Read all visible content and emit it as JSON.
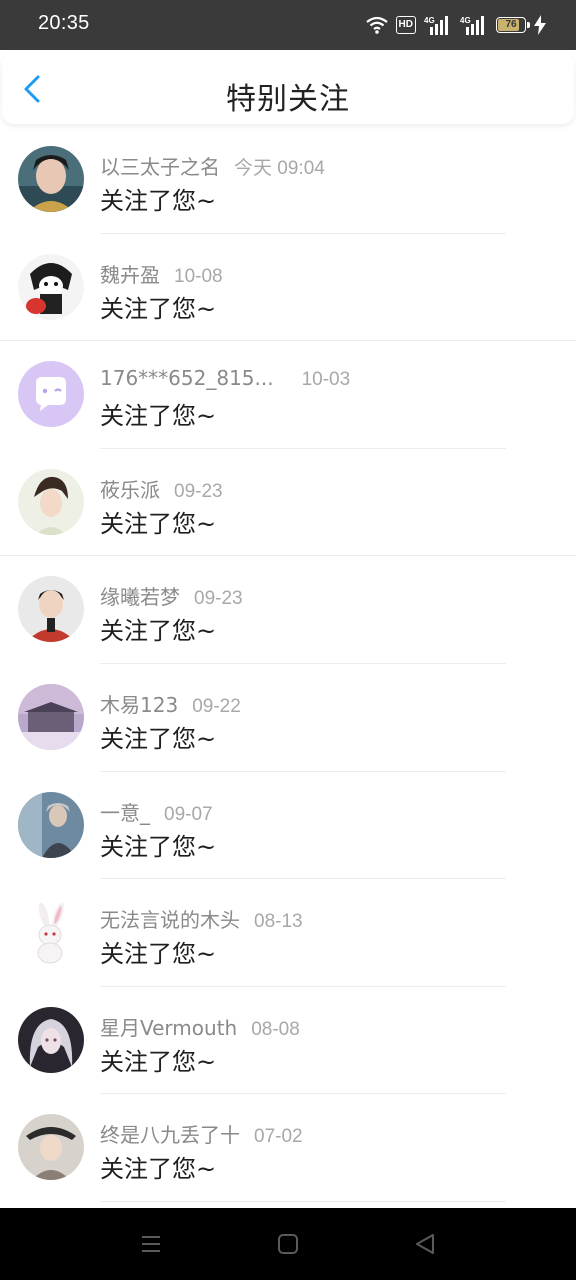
{
  "status_bar": {
    "time": "20:35",
    "hd_label": "HD",
    "signal_label_1": "4G",
    "signal_label_2": "4G",
    "battery_level": "76",
    "battery_fill_fraction": 0.76,
    "battery_color": "#c8b26e"
  },
  "header": {
    "title": "特别关注",
    "back_icon": "chevron-left-icon",
    "accent_color": "#1e9bf0"
  },
  "list": {
    "items": [
      {
        "name": "以三太子之名",
        "date": "今天 09:04",
        "message": "关注了您~",
        "avatar_icon": "user-photo"
      },
      {
        "name": "魏卉盈",
        "date": "10-08",
        "message": "关注了您~",
        "avatar_icon": "user-photo"
      },
      {
        "name": "176***652_815...",
        "date": "10-03",
        "message": "关注了您~",
        "avatar_icon": "default-chat-avatar"
      },
      {
        "name": "莜乐派",
        "date": "09-23",
        "message": "关注了您~",
        "avatar_icon": "user-photo"
      },
      {
        "name": "缘曦若梦",
        "date": "09-23",
        "message": "关注了您~",
        "avatar_icon": "user-photo"
      },
      {
        "name": "木易123",
        "date": "09-22",
        "message": "关注了您~",
        "avatar_icon": "user-photo"
      },
      {
        "name": "一意_",
        "date": "09-07",
        "message": "关注了您~",
        "avatar_icon": "user-photo"
      },
      {
        "name": "无法言说的木头",
        "date": "08-13",
        "message": "关注了您~",
        "avatar_icon": "rabbit-avatar"
      },
      {
        "name": "星月Vermouth",
        "date": "08-08",
        "message": "关注了您~",
        "avatar_icon": "user-photo"
      },
      {
        "name": "终是八九丢了十",
        "date": "07-02",
        "message": "关注了您~",
        "avatar_icon": "user-photo"
      }
    ]
  },
  "nav_bar": {
    "menu_icon": "menu-lines-icon",
    "home_icon": "home-square-icon",
    "back_icon": "back-triangle-icon"
  }
}
